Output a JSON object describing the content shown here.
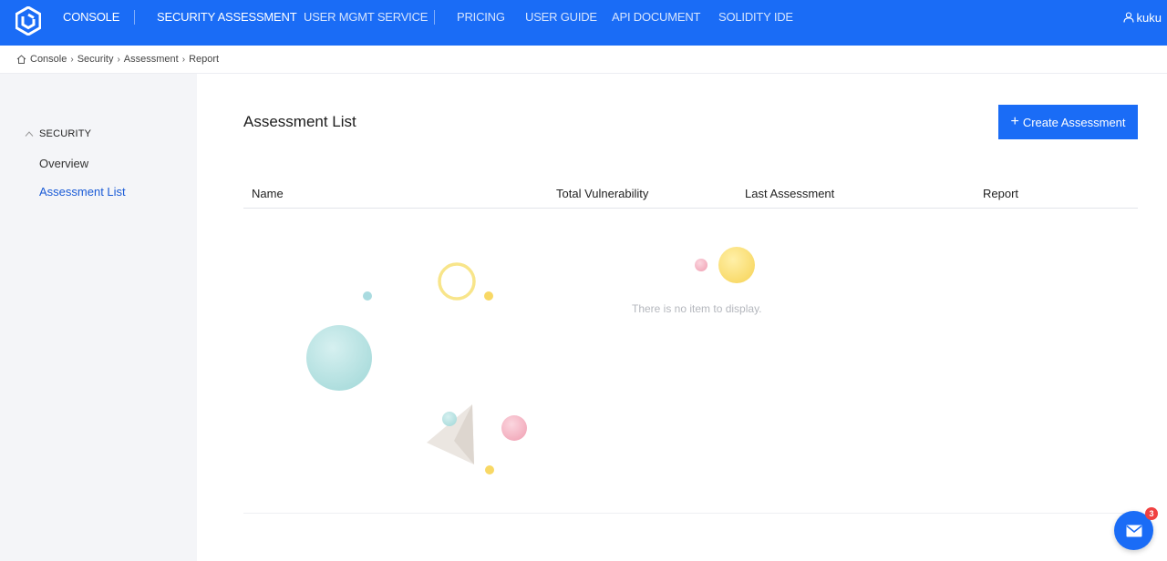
{
  "nav": {
    "console": "CONSOLE",
    "security_assessment": "SECURITY ASSESSMENT",
    "user_mgmt_service": "USER MGMT SERVICE",
    "pricing": "PRICING",
    "user_guide": "USER GUIDE",
    "api_document": "API DOCUMENT",
    "solidity_ide": "SOLIDITY IDE",
    "user_name": "kuku",
    "colors": {
      "bar": "#1a6cf6",
      "text": "#ffffff"
    }
  },
  "breadcrumb": {
    "items": [
      "Console",
      "Security",
      "Assessment",
      "Report"
    ],
    "home_icon": "home-icon",
    "separator_icon": "chevron-right-icon"
  },
  "sidebar": {
    "group_label": "SECURITY",
    "items": [
      {
        "label": "Overview",
        "active": false
      },
      {
        "label": "Assessment List",
        "active": true
      }
    ]
  },
  "main": {
    "title": "Assessment List",
    "create_button": "Create Assessment",
    "columns": [
      "Name",
      "Total Vulnerability",
      "Last Assessment",
      "Report"
    ],
    "empty_text": "There is no item to display."
  },
  "chat": {
    "badge_count": "3",
    "icon": "mail-icon"
  },
  "colors": {
    "accent": "#1a6cf6",
    "active_link": "#1a5bd6",
    "sidebar_bg": "#f4f5f8",
    "empty_text": "#b4b7bd",
    "badge": "#f04141"
  }
}
